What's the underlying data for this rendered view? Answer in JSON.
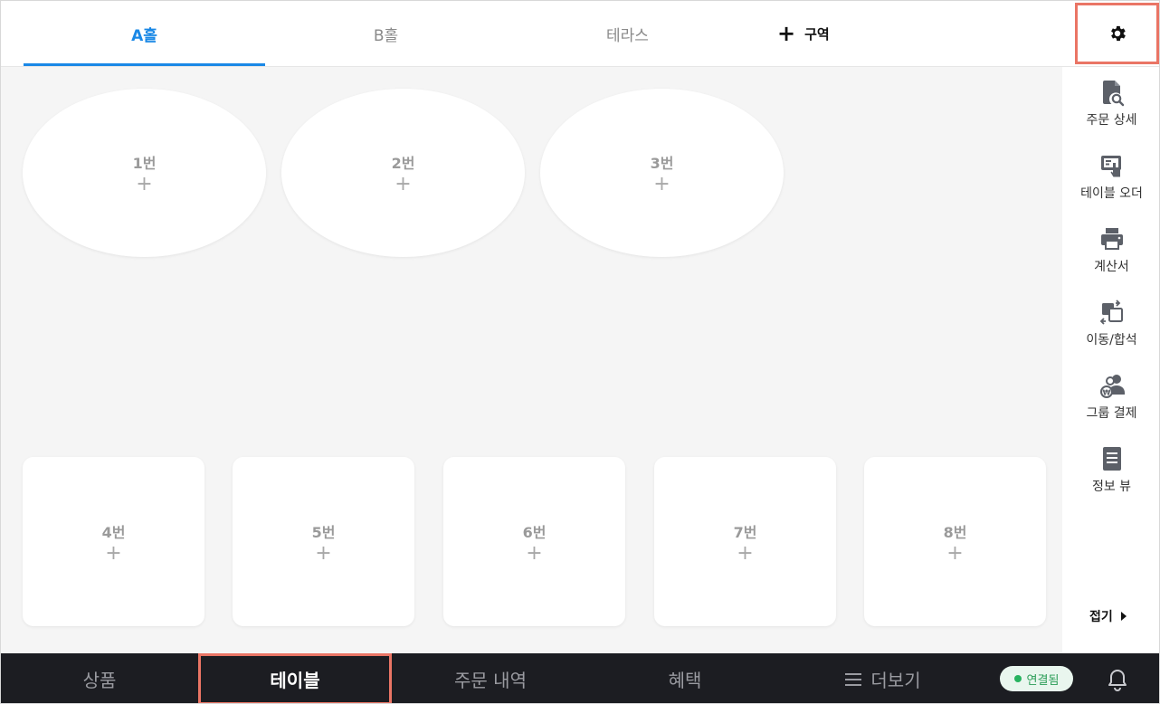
{
  "zones": {
    "tabs": [
      {
        "label": "A홀"
      },
      {
        "label": "B홀"
      },
      {
        "label": "테라스"
      }
    ],
    "add_label": "구역",
    "add_icon": "plus-icon",
    "settings_icon": "gear-icon"
  },
  "floor": {
    "tables": [
      {
        "label": "1번",
        "add": "+"
      },
      {
        "label": "2번",
        "add": "+"
      },
      {
        "label": "3번",
        "add": "+"
      },
      {
        "label": "4번",
        "add": "+"
      },
      {
        "label": "5번",
        "add": "+"
      },
      {
        "label": "6번",
        "add": "+"
      },
      {
        "label": "7번",
        "add": "+"
      },
      {
        "label": "8번",
        "add": "+"
      }
    ]
  },
  "side_panel": {
    "items": [
      {
        "label": "주문 상세",
        "icon": "document-search-icon"
      },
      {
        "label": "테이블 오더",
        "icon": "table-order-icon"
      },
      {
        "label": "계산서",
        "icon": "printer-icon"
      },
      {
        "label": "이동/합석",
        "icon": "move-merge-icon"
      },
      {
        "label": "그룹 결제",
        "icon": "group-payment-icon"
      },
      {
        "label": "정보 뷰",
        "icon": "info-document-icon"
      }
    ],
    "collapse_label": "접기",
    "collapse_icon": "caret-right-icon"
  },
  "bottom_nav": {
    "items": [
      {
        "label": "상품"
      },
      {
        "label": "테이블"
      },
      {
        "label": "주문 내역"
      },
      {
        "label": "혜택"
      },
      {
        "label": "더보기"
      }
    ],
    "more_icon": "menu-icon",
    "status": "연결됨",
    "bell_icon": "bell-icon"
  },
  "colors": {
    "accent_blue": "#1a88e6",
    "highlight_red": "#ea7565",
    "nav_bg": "#1c1d22",
    "status_green": "#27b35f",
    "floor_bg": "#f5f5f5"
  }
}
